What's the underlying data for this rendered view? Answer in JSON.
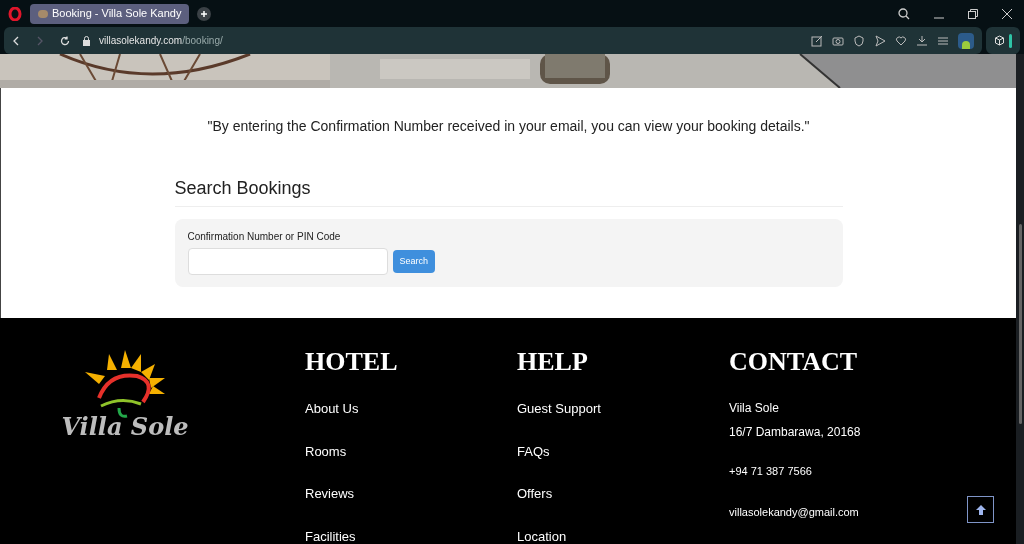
{
  "browser": {
    "tab_title": "Booking - Villa Sole Kandy",
    "url_host": "villasolekandy.com",
    "url_path": "/booking/"
  },
  "intro": "\"By entering the Confirmation Number received in your email, you can view your booking details.\"",
  "search": {
    "heading": "Search Bookings",
    "label": "Confirmation Number or PIN Code",
    "button": "Search"
  },
  "footer": {
    "logo_text": "Villa Sole",
    "columns": [
      {
        "heading": "HOTEL",
        "links": [
          "About Us",
          "Rooms",
          "Reviews",
          "Facilities"
        ]
      },
      {
        "heading": "HELP",
        "links": [
          "Guest Support",
          "FAQs",
          "Offers",
          "Location"
        ]
      }
    ],
    "contact": {
      "heading": "CONTACT",
      "name": "Viila Sole",
      "address": "16/7 Dambarawa, 20168",
      "phone": "+94 71 387 7566",
      "email": "villasolekandy@gmail.com"
    }
  }
}
